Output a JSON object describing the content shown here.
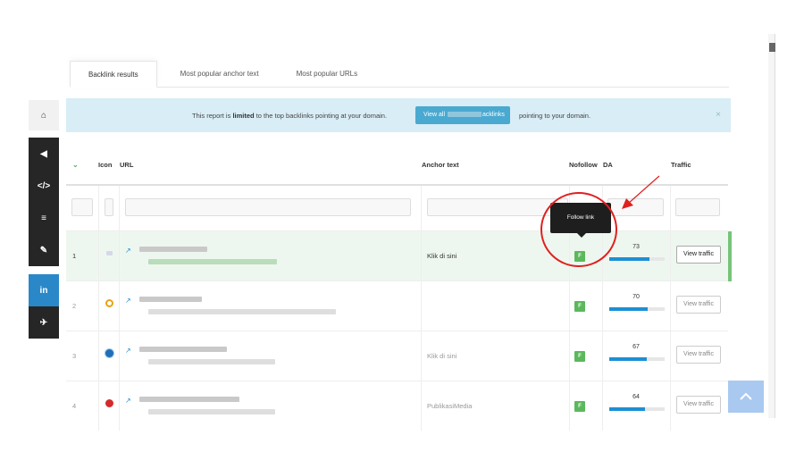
{
  "sidebar": {
    "items": [
      {
        "name": "home",
        "label": "⌂"
      },
      {
        "name": "megaphone",
        "label": "◀"
      },
      {
        "name": "code",
        "label": "</>"
      },
      {
        "name": "list",
        "label": "≡"
      },
      {
        "name": "wrench",
        "label": "✎"
      },
      {
        "name": "linkedin",
        "label": "in"
      },
      {
        "name": "twitter",
        "label": "✈"
      }
    ]
  },
  "tabs": [
    {
      "label": "Backlink results",
      "active": true
    },
    {
      "label": "Most popular anchor text",
      "active": false
    },
    {
      "label": "Most popular URLs",
      "active": false
    }
  ],
  "alert": {
    "message_before": "This report is ",
    "message_bold": "limited",
    "message_after": " to the top backlinks pointing at your domain.",
    "button_prefix": "View all",
    "button_suffix": "acklinks",
    "after_button": "pointing to your domain.",
    "close": "×"
  },
  "table": {
    "headers": {
      "toggle": "⌄",
      "icon": "Icon",
      "url": "URL",
      "anchor": "Anchor text",
      "nofollow": "Nofollow",
      "da": "DA",
      "traffic": "Traffic"
    },
    "rows": [
      {
        "num": "1",
        "anchor": "Klik di sini",
        "nofollow": "F",
        "da": "73",
        "da_fraction": 0.73,
        "traffic": "View traffic",
        "icon_color": "#d6d8e8"
      },
      {
        "num": "2",
        "anchor": "",
        "nofollow": "F",
        "da": "70",
        "da_fraction": 0.7,
        "traffic": "View traffic",
        "icon_color": "#e8a317"
      },
      {
        "num": "3",
        "anchor": "Klik di sini",
        "nofollow": "F",
        "da": "67",
        "da_fraction": 0.67,
        "traffic": "View traffic",
        "icon_color": "#1e6fb8"
      },
      {
        "num": "4",
        "anchor": "PublikasiMedia",
        "nofollow": "F",
        "da": "64",
        "da_fraction": 0.64,
        "traffic": "View traffic",
        "icon_color": "#d42b2b"
      }
    ]
  },
  "tooltip": "Follow link",
  "colors": {
    "alert_bg": "#d8edf6",
    "accent_blue": "#2a88c9",
    "nofollow_green": "#5cb85c",
    "da_bar": "#1c8fd4",
    "annotation_red": "#e02020",
    "highlight_row": "#eef7ef"
  },
  "back_to_top": "⌃"
}
